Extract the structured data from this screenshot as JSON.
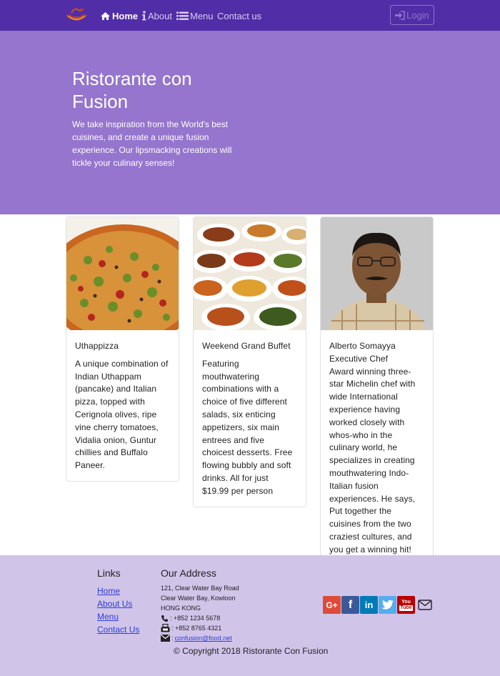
{
  "nav": {
    "items": [
      {
        "label": "Home",
        "icon": "home-icon",
        "active": true
      },
      {
        "label": "About",
        "icon": "info-icon",
        "active": false
      },
      {
        "label": "Menu",
        "icon": "list-icon",
        "active": false
      },
      {
        "label": "Contact us",
        "icon": "",
        "active": false
      }
    ],
    "login_label": "Login"
  },
  "jumbotron": {
    "title": "Ristorante con Fusion",
    "text": "We take inspiration from the World's best cuisines, and create a unique fusion experience. Our lipsmacking creations will tickle your culinary senses!"
  },
  "cards": [
    {
      "title": "Uthappizza",
      "subtitle": "",
      "text": "A unique combination of Indian Uthappam (pancake) and Italian pizza, topped with Cerignola olives, ripe vine cherry tomatoes, Vidalia onion, Guntur chillies and Buffalo Paneer."
    },
    {
      "title": "Weekend Grand Buffet",
      "subtitle": "",
      "text": "Featuring mouthwatering combinations with a choice of five different salads, six enticing appetizers, six main entrees and five choicest desserts. Free flowing bubbly and soft drinks. All for just $19.99 per person"
    },
    {
      "title": "Alberto Somayya",
      "subtitle": "Executive Chef",
      "text": "Award winning three-star Michelin chef with wide International experience having worked closely with whos-who in the culinary world, he specializes in creating mouthwatering Indo-Italian fusion experiences. He says, Put together the cuisines from the two craziest cultures, and you get a winning hit! Amma Mia!"
    }
  ],
  "footer": {
    "links_heading": "Links",
    "links": [
      "Home",
      "About Us",
      "Menu",
      "Contact Us"
    ],
    "address_heading": "Our Address",
    "address_lines": [
      "121, Clear Water Bay Road",
      "Clear Water Bay, Kowloon",
      "HONG KONG"
    ],
    "phone": ": +852 1234 5678",
    "fax": ": +852 8765 4321",
    "email": "confusion@food.net",
    "social": [
      {
        "name": "google-plus",
        "glyph": "G+",
        "color": "#dd4b39"
      },
      {
        "name": "facebook",
        "glyph": "f",
        "color": "#3b5998"
      },
      {
        "name": "linkedin",
        "glyph": "in",
        "color": "#007bb6"
      },
      {
        "name": "twitter",
        "glyph": "t",
        "color": "#55acee"
      },
      {
        "name": "youtube",
        "glyph": "You",
        "color": "#bb0000"
      },
      {
        "name": "mail",
        "glyph": "",
        "color": ""
      }
    ],
    "copyright": "© Copyright 2018 Ristorante Con Fusion"
  },
  "colors": {
    "primary": "#512DA8",
    "jumbotron": "#9575CD",
    "footer": "#D1C4E9"
  }
}
